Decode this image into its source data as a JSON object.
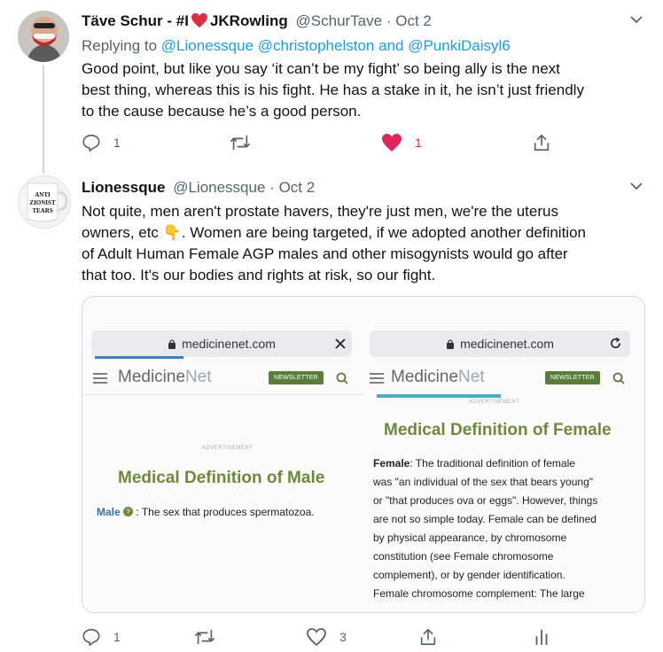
{
  "tweet1": {
    "name": "Täve Schur - #I",
    "name_suffix": "JKRowling",
    "handle": "@SchurTave",
    "dot": "·",
    "date": "Oct 2",
    "replying_prefix": "Replying to",
    "reply_users": [
      "@Lionessque",
      "@christophelston",
      "and",
      "@PunkiDaisyl6"
    ],
    "body_lines": [
      "Good point, but like you say ‘it can’t be my fight’ so being ally is the next",
      "best thing, whereas this is his fight. He has a stake in it, he isn’t just friendly",
      "to the cause because he’s a good person."
    ],
    "reply_count": "1",
    "retweet_count": "",
    "like_count": "1",
    "like_active": true
  },
  "tweet2": {
    "name": "Lionessque",
    "handle": "@Lionessque",
    "dot": "·",
    "date": "Oct 2",
    "avatar_text": [
      "ANTI",
      "ZIONIST",
      "TEARS"
    ],
    "body_lines": [
      "Not quite, men aren't prostate havers, they're just men, we're the uterus",
      "owners, etc",
      ". Women are being targeted, if we adopted another definition",
      "of Adult Human Female AGP males and other misogynists would go after",
      "that too. It's our bodies and rights at risk, so our fight."
    ],
    "emoji": "👇",
    "reply_count": "1",
    "retweet_count": "",
    "like_count": "3"
  },
  "image": {
    "left": {
      "url": "medicinenet.com",
      "brand_a": "Medicine",
      "brand_b": "Net",
      "newsletter": "NEWSLETTER",
      "advertisement": "ADVERTISEMENT",
      "heading": "Medical Definition of Male",
      "term": "Male",
      "definition": ": The sex that produces spermatozoa."
    },
    "right": {
      "url": "medicinenet.com",
      "brand_a": "Medicine",
      "brand_b": "Net",
      "newsletter": "NEWSLETTER",
      "advertisement": "ADVERTISEMENT",
      "heading": "Medical Definition of Female",
      "term": "Female",
      "lines": [
        ": The traditional definition of female",
        "was \"an individual of the sex that bears young\"",
        "or \"that produces ova or eggs\". However, things",
        "are not so simple today. Female can be defined",
        "by physical appearance, by chromosome",
        "constitution (see Female chromosome",
        "complement), or by gender identification.",
        "Female chromosome complement: The large"
      ]
    }
  },
  "colors": {
    "like_red": "#e0245e",
    "link_blue": "#1d9bf0",
    "muted": "#536471",
    "medicine_green": "#6d8a3b"
  },
  "icons": [
    "reply-icon",
    "retweet-icon",
    "like-icon",
    "share-icon",
    "analytics-icon",
    "chevron-down-icon",
    "heart-emoji-icon"
  ]
}
